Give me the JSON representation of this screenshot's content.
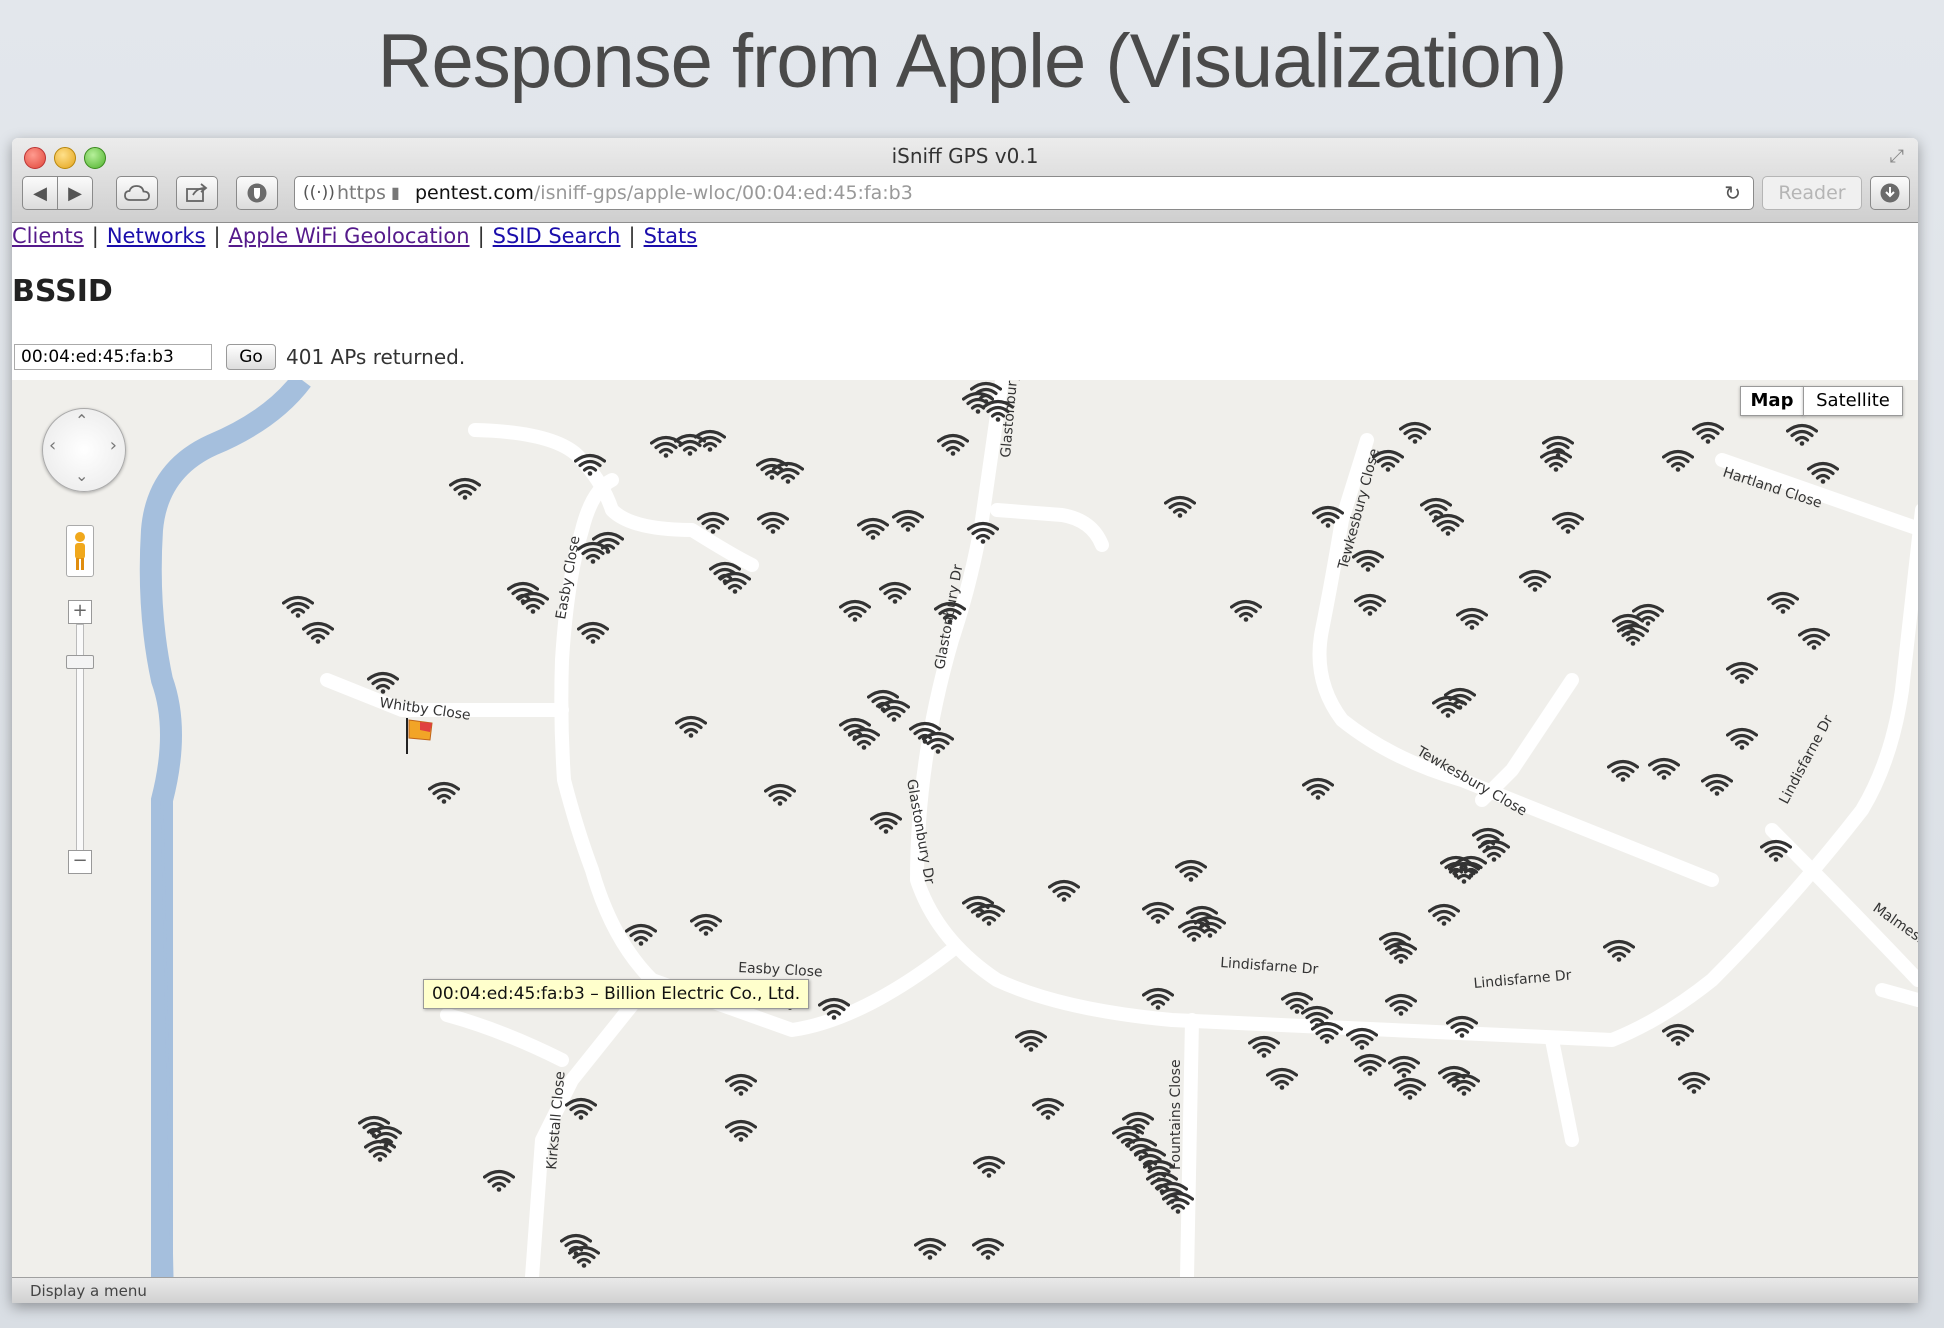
{
  "slide": {
    "title": "Response from Apple (Visualization)"
  },
  "window": {
    "title": "iSniff GPS v0.1"
  },
  "toolbar": {
    "url_scheme": "https",
    "url_host": "pentest.com",
    "url_path": "/isniff-gps/apple-wloc/00:04:ed:45:fa:b3",
    "reader_label": "Reader"
  },
  "nav": {
    "items": [
      {
        "label": "Clients"
      },
      {
        "label": "Networks"
      },
      {
        "label": "Apple WiFi Geolocation"
      },
      {
        "label": "SSID Search"
      },
      {
        "label": "Stats"
      }
    ],
    "separator": "|"
  },
  "page": {
    "heading": "BSSID",
    "input_value": "00:04:ed:45:fa:b3",
    "go_label": "Go",
    "status": "401 APs returned."
  },
  "map": {
    "type_map": "Map",
    "type_satellite": "Satellite",
    "tooltip": "00:04:ed:45:fa:b3 – Billion Electric Co., Ltd.",
    "street_labels": [
      "Glastonbury Dr",
      "Glastonbury Dr",
      "Glastonbury Dr",
      "Easby Close",
      "Easby Close",
      "Whitby Close",
      "Tewkesbury Close",
      "Tewkesbury Close",
      "Hartland Close",
      "Lindisfarne Dr",
      "Lindisfarne Dr",
      "Lindisfarne Dr",
      "Kirkstall Close",
      "Malmesbury",
      "Fountains Close"
    ]
  },
  "statusbar": {
    "text": "Display a menu"
  }
}
